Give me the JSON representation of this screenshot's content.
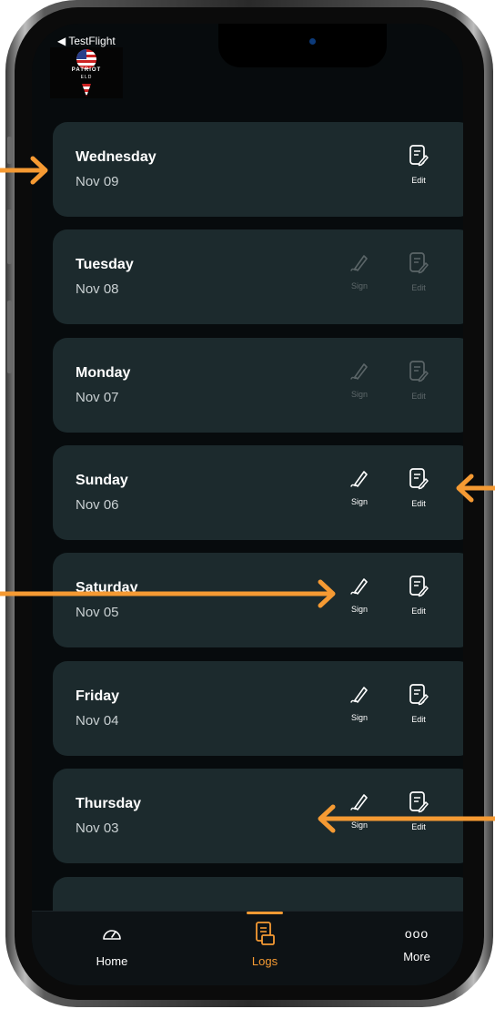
{
  "status_bar": {
    "back_label": "◀ TestFlight"
  },
  "logo": {
    "brand_text": "PATRIOT",
    "sub_text": "ELD"
  },
  "logs": [
    {
      "day": "Wednesday",
      "date": "Nov 09",
      "sign_label": "",
      "edit_label": "Edit",
      "sign_visible": false,
      "enabled": true
    },
    {
      "day": "Tuesday",
      "date": "Nov 08",
      "sign_label": "Sign",
      "edit_label": "Edit",
      "sign_visible": true,
      "enabled": false
    },
    {
      "day": "Monday",
      "date": "Nov 07",
      "sign_label": "Sign",
      "edit_label": "Edit",
      "sign_visible": true,
      "enabled": false
    },
    {
      "day": "Sunday",
      "date": "Nov 06",
      "sign_label": "Sign",
      "edit_label": "Edit",
      "sign_visible": true,
      "enabled": true
    },
    {
      "day": "Saturday",
      "date": "Nov 05",
      "sign_label": "Sign",
      "edit_label": "Edit",
      "sign_visible": true,
      "enabled": true
    },
    {
      "day": "Friday",
      "date": "Nov 04",
      "sign_label": "Sign",
      "edit_label": "Edit",
      "sign_visible": true,
      "enabled": true
    },
    {
      "day": "Thursday",
      "date": "Nov 03",
      "sign_label": "Sign",
      "edit_label": "Edit",
      "sign_visible": true,
      "enabled": true
    }
  ],
  "tabbar": {
    "home_label": "Home",
    "logs_label": "Logs",
    "more_label": "More",
    "more_glyph": "ooo",
    "active_tab": "logs"
  },
  "colors": {
    "accent": "#f59a33",
    "card_bg": "#1c2a2d",
    "screen_bg": "#070b0d"
  },
  "icons": {
    "sign": "pen-signature-icon",
    "edit": "edit-document-icon",
    "home": "speedometer-icon",
    "logs": "logbook-icon",
    "more": "more-dots-icon"
  }
}
